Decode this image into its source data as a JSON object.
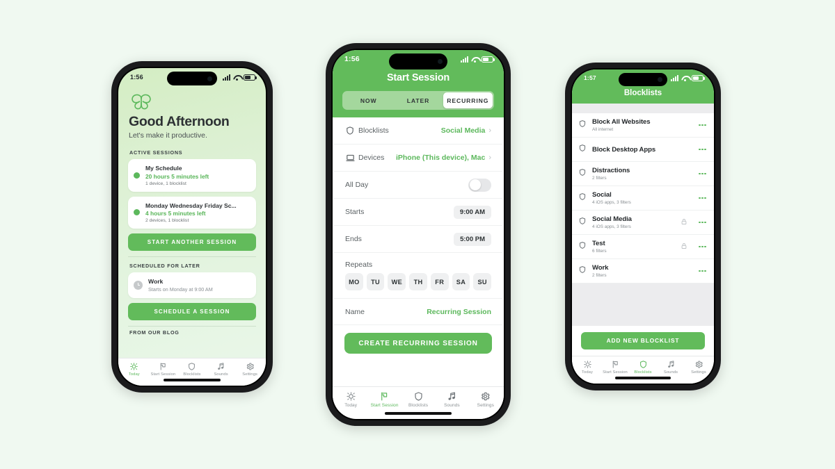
{
  "theme": {
    "brand_green": "#62bb5b",
    "accent_green": "#5cb85c",
    "page_bg": "#f0f9f1"
  },
  "tabs": [
    {
      "label": "Today",
      "icon": "sun-icon"
    },
    {
      "label": "Start Session",
      "icon": "flag-icon"
    },
    {
      "label": "Blocklists",
      "icon": "shield-icon"
    },
    {
      "label": "Sounds",
      "icon": "music-note-icon"
    },
    {
      "label": "Settings",
      "icon": "gear-icon"
    }
  ],
  "phone1": {
    "status": {
      "time": "1:56"
    },
    "logo": "butterfly-logo",
    "greeting": "Good Afternoon",
    "subgreeting": "Let's make it productive.",
    "active_sessions_label": "ACTIVE SESSIONS",
    "active_sessions": [
      {
        "title": "My Schedule",
        "time_left": "20 hours 5 minutes left",
        "meta": "1 device, 1 blocklist"
      },
      {
        "title": "Monday Wednesday Friday Sc...",
        "time_left": "4 hours 5 minutes left",
        "meta": "2 devices, 1 blocklist"
      }
    ],
    "start_another_label": "START ANOTHER SESSION",
    "scheduled_label": "SCHEDULED FOR LATER",
    "scheduled": [
      {
        "title": "Work",
        "meta": "Starts on Monday at 9:00 AM"
      }
    ],
    "schedule_label": "SCHEDULE A SESSION",
    "blog_label": "FROM OUR BLOG",
    "active_tab": "Today"
  },
  "phone2": {
    "status": {
      "time": "1:56"
    },
    "title": "Start Session",
    "segments": [
      "NOW",
      "LATER",
      "RECURRING"
    ],
    "selected_segment": "RECURRING",
    "rows": [
      {
        "label": "Blocklists",
        "value": "Social Media",
        "icon": "shield-icon"
      },
      {
        "label": "Devices",
        "value": "iPhone (This device), Mac",
        "icon": "laptop-icon"
      }
    ],
    "all_day": {
      "label": "All Day",
      "on": false
    },
    "starts": {
      "label": "Starts",
      "value": "9:00 AM"
    },
    "ends": {
      "label": "Ends",
      "value": "5:00 PM"
    },
    "repeats_label": "Repeats",
    "days": [
      "MO",
      "TU",
      "WE",
      "TH",
      "FR",
      "SA",
      "SU"
    ],
    "name": {
      "label": "Name",
      "value": "Recurring Session"
    },
    "cta_label": "CREATE RECURRING SESSION",
    "active_tab": "Start Session"
  },
  "phone3": {
    "status": {
      "time": "1:57"
    },
    "title": "Blocklists",
    "items": [
      {
        "name": "Block All Websites",
        "sub": "All internet",
        "locked": false
      },
      {
        "name": "Block Desktop Apps",
        "sub": "",
        "locked": false
      },
      {
        "name": "Distractions",
        "sub": "2 filters",
        "locked": false
      },
      {
        "name": "Social",
        "sub": "4 iOS apps, 3 filters",
        "locked": false
      },
      {
        "name": "Social Media",
        "sub": "4 iOS apps, 3 filters",
        "locked": true
      },
      {
        "name": "Test",
        "sub": "6 filters",
        "locked": true
      },
      {
        "name": "Work",
        "sub": "2 filters",
        "locked": false
      }
    ],
    "cta_label": "ADD NEW BLOCKLIST",
    "active_tab": "Blocklists"
  }
}
